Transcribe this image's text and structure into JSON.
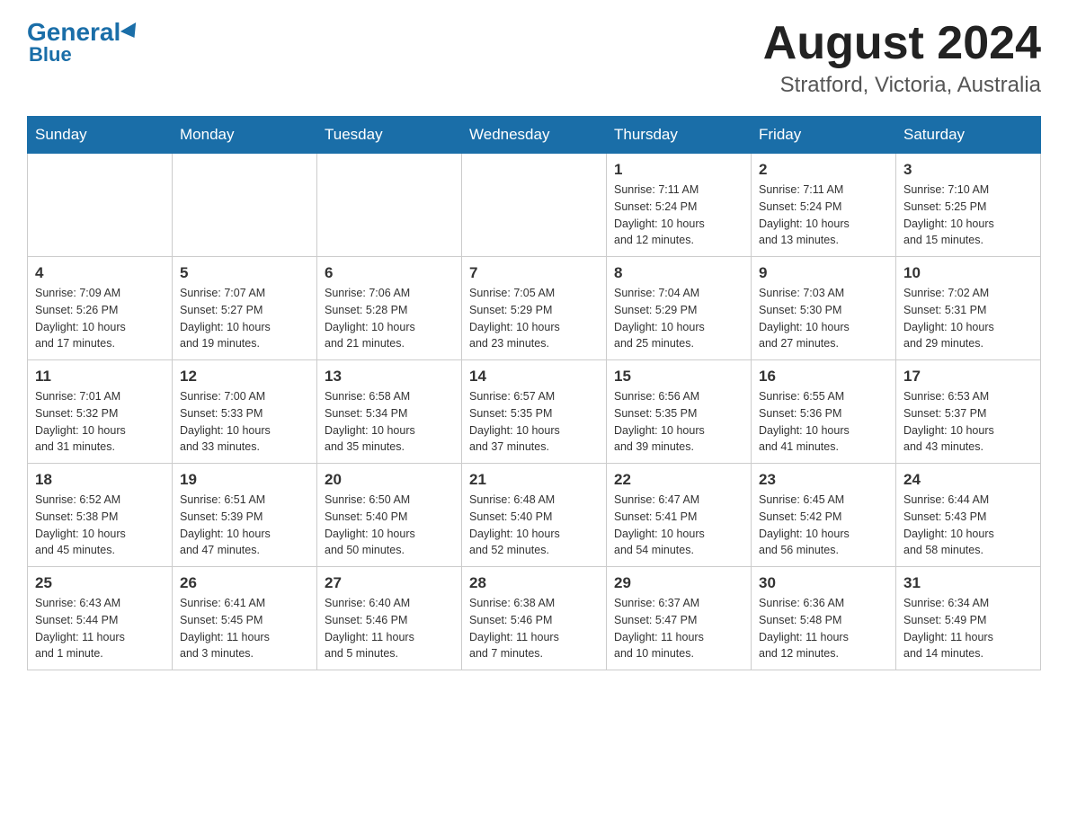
{
  "header": {
    "logo_text": "General",
    "logo_blue": "Blue",
    "month": "August 2024",
    "location": "Stratford, Victoria, Australia"
  },
  "weekdays": [
    "Sunday",
    "Monday",
    "Tuesday",
    "Wednesday",
    "Thursday",
    "Friday",
    "Saturday"
  ],
  "weeks": [
    [
      {
        "day": "",
        "info": ""
      },
      {
        "day": "",
        "info": ""
      },
      {
        "day": "",
        "info": ""
      },
      {
        "day": "",
        "info": ""
      },
      {
        "day": "1",
        "info": "Sunrise: 7:11 AM\nSunset: 5:24 PM\nDaylight: 10 hours\nand 12 minutes."
      },
      {
        "day": "2",
        "info": "Sunrise: 7:11 AM\nSunset: 5:24 PM\nDaylight: 10 hours\nand 13 minutes."
      },
      {
        "day": "3",
        "info": "Sunrise: 7:10 AM\nSunset: 5:25 PM\nDaylight: 10 hours\nand 15 minutes."
      }
    ],
    [
      {
        "day": "4",
        "info": "Sunrise: 7:09 AM\nSunset: 5:26 PM\nDaylight: 10 hours\nand 17 minutes."
      },
      {
        "day": "5",
        "info": "Sunrise: 7:07 AM\nSunset: 5:27 PM\nDaylight: 10 hours\nand 19 minutes."
      },
      {
        "day": "6",
        "info": "Sunrise: 7:06 AM\nSunset: 5:28 PM\nDaylight: 10 hours\nand 21 minutes."
      },
      {
        "day": "7",
        "info": "Sunrise: 7:05 AM\nSunset: 5:29 PM\nDaylight: 10 hours\nand 23 minutes."
      },
      {
        "day": "8",
        "info": "Sunrise: 7:04 AM\nSunset: 5:29 PM\nDaylight: 10 hours\nand 25 minutes."
      },
      {
        "day": "9",
        "info": "Sunrise: 7:03 AM\nSunset: 5:30 PM\nDaylight: 10 hours\nand 27 minutes."
      },
      {
        "day": "10",
        "info": "Sunrise: 7:02 AM\nSunset: 5:31 PM\nDaylight: 10 hours\nand 29 minutes."
      }
    ],
    [
      {
        "day": "11",
        "info": "Sunrise: 7:01 AM\nSunset: 5:32 PM\nDaylight: 10 hours\nand 31 minutes."
      },
      {
        "day": "12",
        "info": "Sunrise: 7:00 AM\nSunset: 5:33 PM\nDaylight: 10 hours\nand 33 minutes."
      },
      {
        "day": "13",
        "info": "Sunrise: 6:58 AM\nSunset: 5:34 PM\nDaylight: 10 hours\nand 35 minutes."
      },
      {
        "day": "14",
        "info": "Sunrise: 6:57 AM\nSunset: 5:35 PM\nDaylight: 10 hours\nand 37 minutes."
      },
      {
        "day": "15",
        "info": "Sunrise: 6:56 AM\nSunset: 5:35 PM\nDaylight: 10 hours\nand 39 minutes."
      },
      {
        "day": "16",
        "info": "Sunrise: 6:55 AM\nSunset: 5:36 PM\nDaylight: 10 hours\nand 41 minutes."
      },
      {
        "day": "17",
        "info": "Sunrise: 6:53 AM\nSunset: 5:37 PM\nDaylight: 10 hours\nand 43 minutes."
      }
    ],
    [
      {
        "day": "18",
        "info": "Sunrise: 6:52 AM\nSunset: 5:38 PM\nDaylight: 10 hours\nand 45 minutes."
      },
      {
        "day": "19",
        "info": "Sunrise: 6:51 AM\nSunset: 5:39 PM\nDaylight: 10 hours\nand 47 minutes."
      },
      {
        "day": "20",
        "info": "Sunrise: 6:50 AM\nSunset: 5:40 PM\nDaylight: 10 hours\nand 50 minutes."
      },
      {
        "day": "21",
        "info": "Sunrise: 6:48 AM\nSunset: 5:40 PM\nDaylight: 10 hours\nand 52 minutes."
      },
      {
        "day": "22",
        "info": "Sunrise: 6:47 AM\nSunset: 5:41 PM\nDaylight: 10 hours\nand 54 minutes."
      },
      {
        "day": "23",
        "info": "Sunrise: 6:45 AM\nSunset: 5:42 PM\nDaylight: 10 hours\nand 56 minutes."
      },
      {
        "day": "24",
        "info": "Sunrise: 6:44 AM\nSunset: 5:43 PM\nDaylight: 10 hours\nand 58 minutes."
      }
    ],
    [
      {
        "day": "25",
        "info": "Sunrise: 6:43 AM\nSunset: 5:44 PM\nDaylight: 11 hours\nand 1 minute."
      },
      {
        "day": "26",
        "info": "Sunrise: 6:41 AM\nSunset: 5:45 PM\nDaylight: 11 hours\nand 3 minutes."
      },
      {
        "day": "27",
        "info": "Sunrise: 6:40 AM\nSunset: 5:46 PM\nDaylight: 11 hours\nand 5 minutes."
      },
      {
        "day": "28",
        "info": "Sunrise: 6:38 AM\nSunset: 5:46 PM\nDaylight: 11 hours\nand 7 minutes."
      },
      {
        "day": "29",
        "info": "Sunrise: 6:37 AM\nSunset: 5:47 PM\nDaylight: 11 hours\nand 10 minutes."
      },
      {
        "day": "30",
        "info": "Sunrise: 6:36 AM\nSunset: 5:48 PM\nDaylight: 11 hours\nand 12 minutes."
      },
      {
        "day": "31",
        "info": "Sunrise: 6:34 AM\nSunset: 5:49 PM\nDaylight: 11 hours\nand 14 minutes."
      }
    ]
  ]
}
